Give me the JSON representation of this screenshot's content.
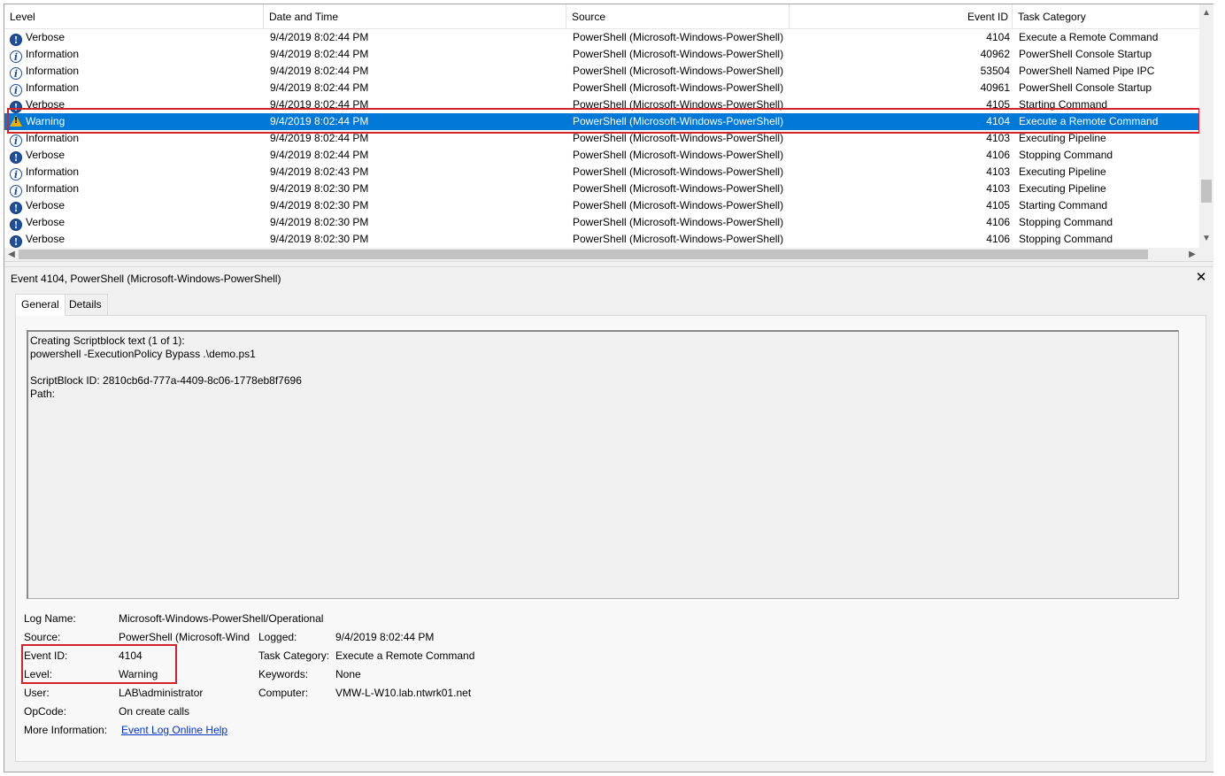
{
  "columns": {
    "level": "Level",
    "date": "Date and Time",
    "source": "Source",
    "event_id": "Event ID",
    "task": "Task Category"
  },
  "rows": [
    {
      "level": "Verbose",
      "icon": "verbose-icon",
      "date": "9/4/2019 8:02:44 PM",
      "source": "PowerShell (Microsoft-Windows-PowerShell)",
      "event_id": "4104",
      "task": "Execute a Remote Command"
    },
    {
      "level": "Information",
      "icon": "information-icon",
      "date": "9/4/2019 8:02:44 PM",
      "source": "PowerShell (Microsoft-Windows-PowerShell)",
      "event_id": "40962",
      "task": "PowerShell Console Startup"
    },
    {
      "level": "Information",
      "icon": "information-icon",
      "date": "9/4/2019 8:02:44 PM",
      "source": "PowerShell (Microsoft-Windows-PowerShell)",
      "event_id": "53504",
      "task": "PowerShell Named Pipe IPC"
    },
    {
      "level": "Information",
      "icon": "information-icon",
      "date": "9/4/2019 8:02:44 PM",
      "source": "PowerShell (Microsoft-Windows-PowerShell)",
      "event_id": "40961",
      "task": "PowerShell Console Startup"
    },
    {
      "level": "Verbose",
      "icon": "verbose-icon",
      "date": "9/4/2019 8:02:44 PM",
      "source": "PowerShell (Microsoft-Windows-PowerShell)",
      "event_id": "4105",
      "task": "Starting Command"
    },
    {
      "level": "Warning",
      "icon": "warning-icon",
      "date": "9/4/2019 8:02:44 PM",
      "source": "PowerShell (Microsoft-Windows-PowerShell)",
      "event_id": "4104",
      "task": "Execute a Remote Command",
      "selected": true
    },
    {
      "level": "Information",
      "icon": "information-icon",
      "date": "9/4/2019 8:02:44 PM",
      "source": "PowerShell (Microsoft-Windows-PowerShell)",
      "event_id": "4103",
      "task": "Executing Pipeline"
    },
    {
      "level": "Verbose",
      "icon": "verbose-icon",
      "date": "9/4/2019 8:02:44 PM",
      "source": "PowerShell (Microsoft-Windows-PowerShell)",
      "event_id": "4106",
      "task": "Stopping Command"
    },
    {
      "level": "Information",
      "icon": "information-icon",
      "date": "9/4/2019 8:02:43 PM",
      "source": "PowerShell (Microsoft-Windows-PowerShell)",
      "event_id": "4103",
      "task": "Executing Pipeline"
    },
    {
      "level": "Information",
      "icon": "information-icon",
      "date": "9/4/2019 8:02:30 PM",
      "source": "PowerShell (Microsoft-Windows-PowerShell)",
      "event_id": "4103",
      "task": "Executing Pipeline"
    },
    {
      "level": "Verbose",
      "icon": "verbose-icon",
      "date": "9/4/2019 8:02:30 PM",
      "source": "PowerShell (Microsoft-Windows-PowerShell)",
      "event_id": "4105",
      "task": "Starting Command"
    },
    {
      "level": "Verbose",
      "icon": "verbose-icon",
      "date": "9/4/2019 8:02:30 PM",
      "source": "PowerShell (Microsoft-Windows-PowerShell)",
      "event_id": "4106",
      "task": "Stopping Command"
    },
    {
      "level": "Verbose",
      "icon": "verbose-icon",
      "date": "9/4/2019 8:02:30 PM",
      "source": "PowerShell (Microsoft-Windows-PowerShell)",
      "event_id": "4106",
      "task": "Stopping Command"
    }
  ],
  "detail": {
    "title": "Event 4104, PowerShell (Microsoft-Windows-PowerShell)",
    "close_glyph": "✕",
    "tabs": [
      "General",
      "Details"
    ],
    "message_lines": [
      "Creating Scriptblock text (1 of 1):",
      "powershell -ExecutionPolicy Bypass .\\demo.ps1",
      "",
      "ScriptBlock ID: 2810cb6d-777a-4409-8c06-1778eb8f7696",
      "Path:"
    ],
    "props": {
      "log_name_label": "Log Name:",
      "log_name": "Microsoft-Windows-PowerShell/Operational",
      "source_label": "Source:",
      "source": "PowerShell (Microsoft-Wind",
      "logged_label": "Logged:",
      "logged": "9/4/2019 8:02:44 PM",
      "event_id_label": "Event ID:",
      "event_id": "4104",
      "task_label": "Task Category:",
      "task": "Execute a Remote Command",
      "level_label": "Level:",
      "level": "Warning",
      "keywords_label": "Keywords:",
      "keywords": "None",
      "user_label": "User:",
      "user": "LAB\\administrator",
      "computer_label": "Computer:",
      "computer": "VMW-L-W10.lab.ntwrk01.net",
      "opcode_label": "OpCode:",
      "opcode": "On create calls",
      "more_info_label": "More Information:",
      "more_info_link": "Event Log Online Help"
    }
  },
  "colors": {
    "selection": "#0078d7",
    "highlight_box": "#d0232c",
    "link": "#0033cc"
  }
}
